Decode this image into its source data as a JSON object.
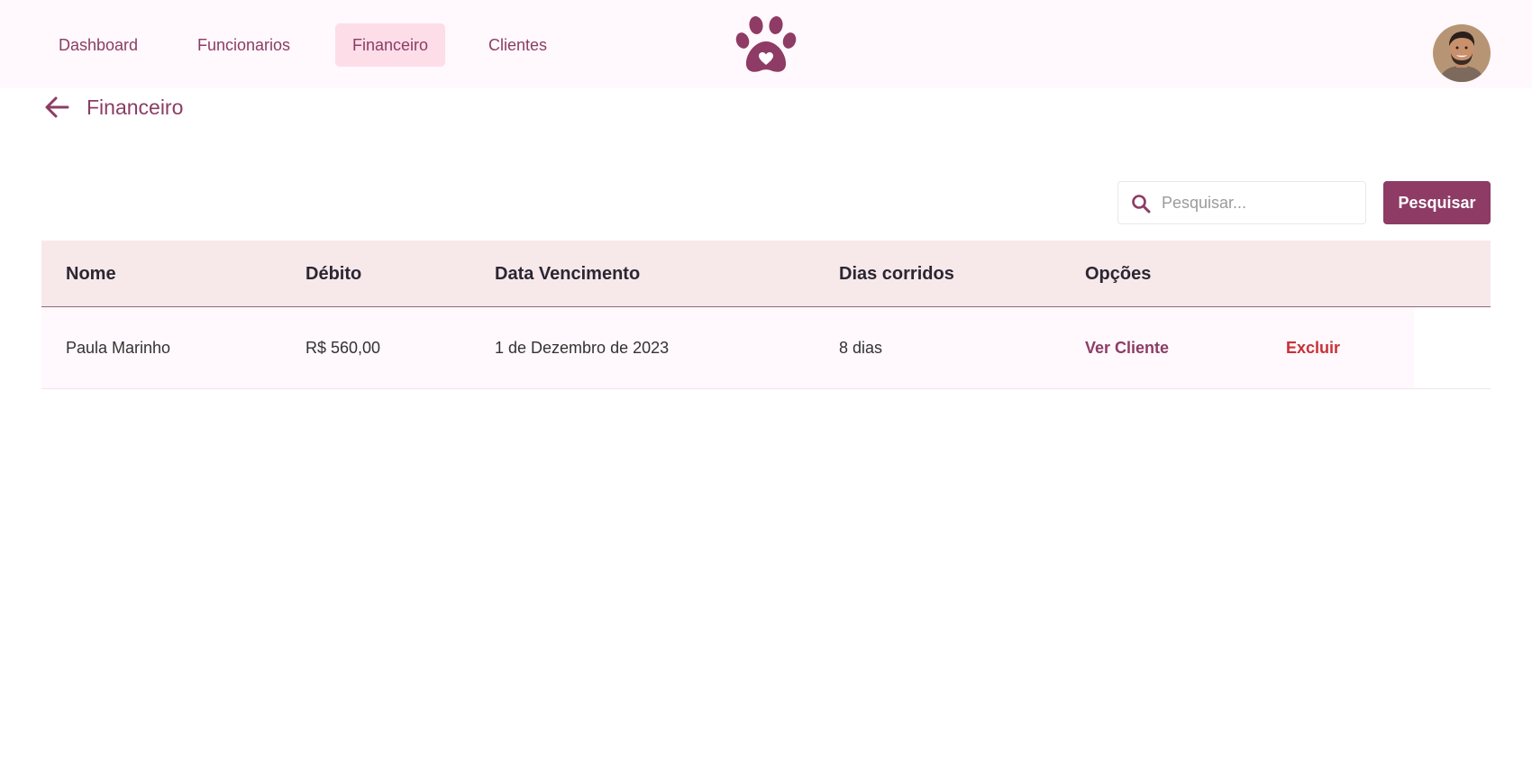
{
  "nav": {
    "items": [
      {
        "label": "Dashboard"
      },
      {
        "label": "Funcionarios"
      },
      {
        "label": "Financeiro"
      },
      {
        "label": "Clientes"
      }
    ],
    "active": "Financeiro",
    "logo_icon": "paw-heart-icon",
    "avatar_icon": "user-avatar"
  },
  "page": {
    "title": "Financeiro",
    "back_icon": "arrow-left-icon"
  },
  "search": {
    "placeholder": "Pesquisar...",
    "value": "",
    "button_label": "Pesquisar",
    "icon": "search-icon"
  },
  "table": {
    "headers": {
      "nome": "Nome",
      "debito": "Débito",
      "data": "Data Vencimento",
      "dias": "Dias corridos",
      "opcoes": "Opções"
    },
    "rows": [
      {
        "nome": "Paula Marinho",
        "debito": "R$ 560,00",
        "data": "1 de Dezembro de 2023",
        "dias": "8 dias",
        "ver": "Ver Cliente",
        "excluir": "Excluir"
      }
    ]
  },
  "colors": {
    "brand": "#8e3b65",
    "nav_bg": "#fff8fc",
    "nav_active_bg": "#fddde8",
    "table_header_bg": "#f7e8ea",
    "danger": "#c93036"
  }
}
